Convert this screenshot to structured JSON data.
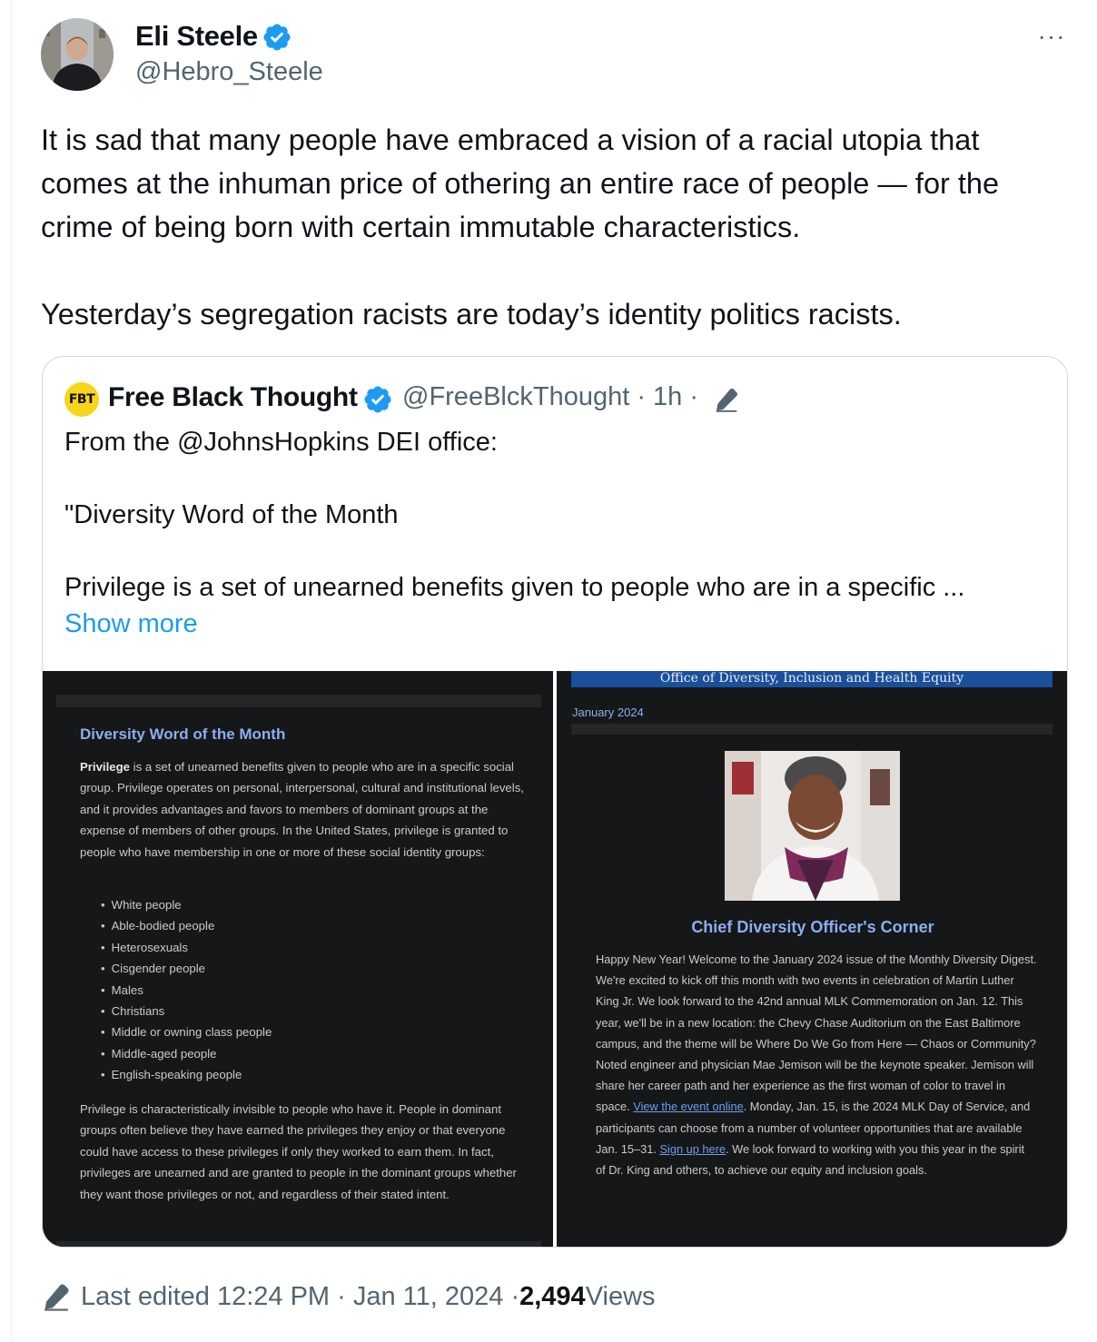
{
  "author": {
    "display_name": "Eli Steele",
    "handle": "@Hebro_Steele",
    "verified_icon": "verified-badge-icon",
    "more_label": "···"
  },
  "tweet": {
    "text_p1": "It is sad that many people have embraced a vision of a racial utopia that comes at the inhuman price of othering an entire race of people — for the crime of being born with certain immutable characteristics.",
    "text_p2": "Yesterday’s segregation racists are today’s identity politics racists."
  },
  "quote": {
    "logo_text": "FBT",
    "display_name": "Free Black Thought",
    "handle": "@FreeBlckThought",
    "time_meta": " · 1h ·",
    "line1": "From the @JohnsHopkins DEI office:",
    "line2": "\"Diversity Word of the Month",
    "line3": "Privilege is a set of unearned benefits given to people who are in a specific ...",
    "show_more": "Show more"
  },
  "media_left": {
    "title": "Diversity Word of the Month",
    "term": "Privilege",
    "para1": " is a set of unearned benefits given to people who are in a specific social group. Privilege operates on personal, interpersonal, cultural and institutional levels, and it provides advantages and favors to members of dominant groups at the expense of members of other groups. In the United States, privilege is granted to people who have membership in one or more of these social identity groups:",
    "list": [
      "White people",
      "Able-bodied people",
      "Heterosexuals",
      "Cisgender people",
      "Males",
      "Christians",
      "Middle or owning class people",
      "Middle-aged people",
      "English-speaking people"
    ],
    "para2": "Privilege is characteristically invisible to people who have it. People in dominant groups often believe they have earned the privileges they enjoy or that everyone could have access to these privileges if only they worked to earn them. In fact, privileges are unearned and are granted to people in the dominant groups whether they want those privileges or not, and regardless of their stated intent."
  },
  "media_right": {
    "banner": "Office of Diversity, Inclusion and Health Equity",
    "date": "January 2024",
    "title": "Chief Diversity Officer's Corner",
    "para_a": "Happy New Year! Welcome to the January 2024 issue of the Monthly Diversity Digest. We're excited to kick off this month with two events in celebration of Martin Luther King Jr. We look forward to the 42nd annual MLK Commemoration on Jan. 12. This year, we'll be in a new location: the Chevy Chase Auditorium on the East Baltimore campus, and the theme will be Where Do We Go from Here — Chaos or Community? Noted engineer and physician Mae Jemison will be the keynote speaker. Jemison will share her career path and her experience as the first woman of color to travel in space. ",
    "link1": "View the event online",
    "para_b": ". Monday, Jan. 15, is the 2024 MLK Day of Service, and participants can choose from a number of volunteer opportunities that are available Jan. 15–31. ",
    "link2": "Sign up here",
    "para_c": ". We look forward to working with you this year in the spirit of Dr. King and others, to achieve our equity and inclusion goals."
  },
  "footer": {
    "edited": "Last edited 12:24 PM · Jan 11, 2024 · ",
    "views_count": "2,494",
    "views_label": " Views"
  },
  "colors": {
    "accent": "#1d9bf0",
    "verified": "#1d9bf0",
    "muted": "#536471",
    "media_heading": "#8aaef0"
  }
}
